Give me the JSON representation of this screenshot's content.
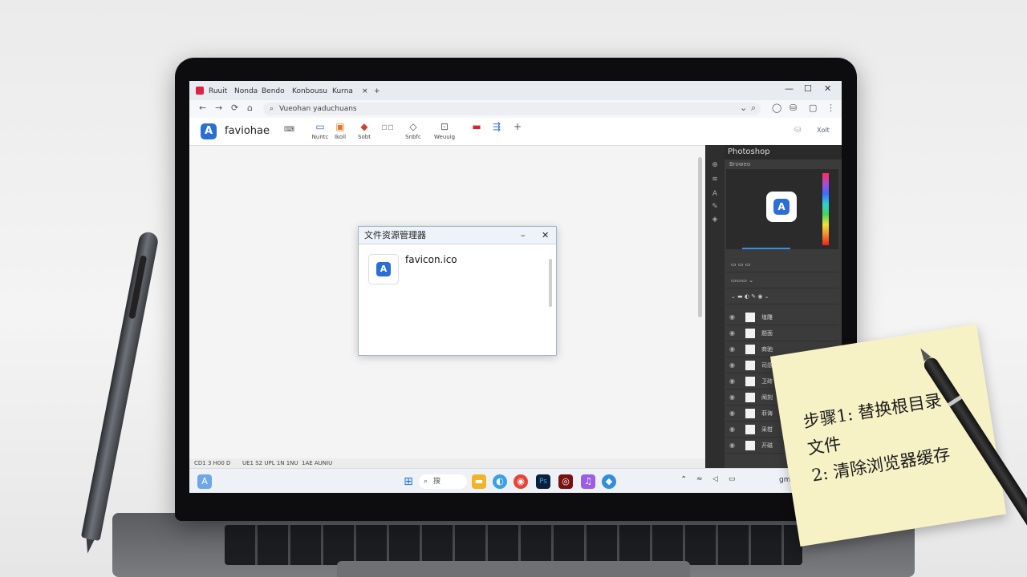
{
  "browser": {
    "tabs": [
      "Ruuit",
      "Nonda",
      "Bendo",
      "Konbousu",
      "Kurna"
    ],
    "tab_close": "×",
    "new_tab": "+",
    "url": "Vueohan yaduchuans",
    "window_controls": [
      "—",
      "☐",
      "✕"
    ]
  },
  "app_toolbar": {
    "brand": "faviohae",
    "brand_logo": "A",
    "tools": [
      {
        "label": "Nuntc",
        "icon": "page-icon"
      },
      {
        "label": "Ikoll",
        "icon": "image-icon"
      },
      {
        "label": "Sobt",
        "icon": "shapes-icon"
      },
      {
        "label": "",
        "icon": "grid-icon"
      },
      {
        "label": "Snbfc",
        "icon": "diamond-icon"
      },
      {
        "label": "Weuuig",
        "icon": "frame-icon"
      },
      {
        "label": "",
        "icon": "badge-icon"
      },
      {
        "label": "",
        "icon": "share-icon"
      },
      {
        "label": "",
        "icon": "plus-icon"
      }
    ],
    "right_label": "Xolt"
  },
  "explorer": {
    "title": "文件资源管理器",
    "minimize": "–",
    "close": "✕",
    "file_name": "favicon.ico",
    "file_icon": "A"
  },
  "photoshop": {
    "title": "Photoshop",
    "subtitle": "Broweo",
    "layers": [
      "埴雕",
      "题面",
      "商驰",
      "司感",
      "卫砖",
      "阐刻",
      "菲诲",
      "采柑",
      "开磁"
    ]
  },
  "status_bar": [
    "CD1 3 H00 D",
    "UE1 S2 UPL 1N 1NU",
    "1AE AUNIU"
  ],
  "taskbar": {
    "widget": "A",
    "search_placeholder": "搜",
    "tray_text": "gm"
  },
  "sticky_note": {
    "text": "步骤1: 替换根目录\n文件\n  2: 清除浏览器缓存"
  },
  "colors": {
    "accent": "#2b6fd6",
    "ps_dark": "#3b3b3b",
    "note": "#f6f2c6"
  }
}
